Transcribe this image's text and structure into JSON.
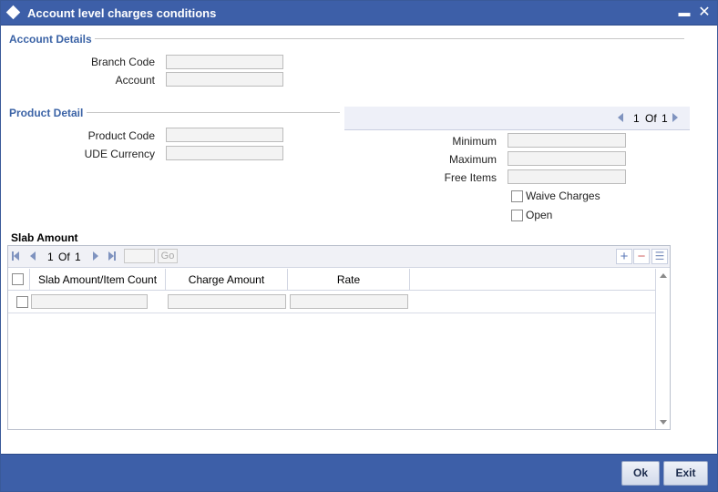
{
  "window": {
    "title": "Account level charges conditions",
    "minimize_glyph": "▬",
    "close_glyph": "✕"
  },
  "account_details": {
    "section_title": "Account Details",
    "branch_code_label": "Branch Code",
    "branch_code_value": "",
    "account_label": "Account",
    "account_value": ""
  },
  "product_detail": {
    "section_title": "Product Detail",
    "product_code_label": "Product Code",
    "product_code_value": "",
    "ude_currency_label": "UDE Currency",
    "ude_currency_value": ""
  },
  "charges_pager": {
    "current": "1",
    "of_label": "Of",
    "total": "1"
  },
  "charges": {
    "minimum_label": "Minimum",
    "minimum_value": "",
    "maximum_label": "Maximum",
    "maximum_value": "",
    "free_items_label": "Free Items",
    "free_items_value": "",
    "waive_charges_label": "Waive Charges",
    "waive_charges_checked": false,
    "open_label": "Open",
    "open_checked": false
  },
  "slab_amount": {
    "section_title": "Slab Amount",
    "pager": {
      "current": "1",
      "of_label": "Of",
      "total": "1",
      "go_label": "Go"
    },
    "toolbar": {
      "add_glyph": "+",
      "delete_glyph": "−",
      "view_glyph": "☰"
    },
    "columns": [
      "Slab Amount/Item Count",
      "Charge Amount",
      "Rate"
    ],
    "rows": [
      {
        "slab_amount": "",
        "charge_amount": "",
        "rate": ""
      }
    ]
  },
  "footer": {
    "ok_label": "Ok",
    "exit_label": "Exit"
  },
  "colors": {
    "titlebar": "#3d5fa8",
    "section_title": "#3b63a6",
    "field_bg": "#f3f3f3"
  }
}
